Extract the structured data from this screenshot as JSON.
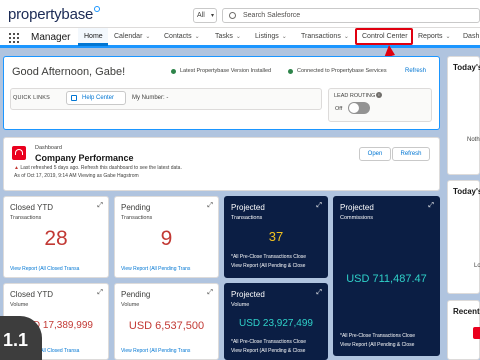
{
  "header": {
    "logo_text": "propertybase",
    "search_scope": "All",
    "search_placeholder": "Search Salesforce"
  },
  "nav": {
    "app_name": "Manager",
    "tabs": [
      {
        "label": "Home",
        "active": true
      },
      {
        "label": "Calendar"
      },
      {
        "label": "Contacts"
      },
      {
        "label": "Tasks"
      },
      {
        "label": "Listings"
      },
      {
        "label": "Transactions"
      },
      {
        "label": "Control Center",
        "highlighted": true
      },
      {
        "label": "Reports"
      },
      {
        "label": "Dash"
      }
    ]
  },
  "greeting": {
    "title": "Good Afternoon, Gabe!",
    "status_version": "Latest Propertybase Version Installed",
    "status_connected": "Connected to Propertybase Services",
    "refresh_label": "Refresh",
    "quick_links_label": "QUICK LINKS",
    "help_center_label": "Help Center",
    "my_number": "My Number: -",
    "lead_routing_label": "LEAD ROUTING",
    "lead_routing_state": "Off"
  },
  "dashboard": {
    "kicker": "Dashboard",
    "title": "Company Performance",
    "refresh_warning": "Last refreshed 5 days ago. Refresh this dashboard to see the latest data.",
    "as_of": "As of Oct 17, 2019, 9:14 AM Viewing as Gabe Hagstrom",
    "open_label": "Open",
    "refresh_label": "Refresh"
  },
  "tiles": {
    "closed_tx": {
      "title": "Closed YTD",
      "subtitle": "Transactions",
      "value": "28",
      "link": "View Report (All Closed Transa"
    },
    "pending_tx": {
      "title": "Pending",
      "subtitle": "Transactions",
      "value": "9",
      "link": "View Report (All Pending Trans"
    },
    "proj_tx": {
      "title": "Projected",
      "subtitle": "Transactions",
      "value": "37",
      "foot1": "*All Pre-Close Transactions Close",
      "foot2": "View Report (All Pending & Close"
    },
    "proj_comm": {
      "title": "Projected",
      "subtitle": "Commissions",
      "value": "USD 711,487.47"
    },
    "closed_vol": {
      "title": "Closed YTD",
      "subtitle": "Volume",
      "value": "USD 17,389,999",
      "link": "View Report (All Closed Transa"
    },
    "pending_vol": {
      "title": "Pending",
      "subtitle": "Volume",
      "value": "USD 6,537,500",
      "link": "View Report (All Pending Trans"
    },
    "proj_vol": {
      "title": "Projected",
      "subtitle": "Volume",
      "value": "USD 23,927,499",
      "foot1": "*All Pre-Close Transactions Close",
      "foot2": "View Report (All Pending & Close"
    },
    "proj_comm_foot1": "*All Pre-Close Transactions Close",
    "proj_comm_foot2": "View Report (All Pending & Close"
  },
  "rail": {
    "card1_title": "Today's",
    "card1_frag": "Noth",
    "card2_title": "Today's",
    "card2_frag": "Lo",
    "card3_title": "Recent I"
  },
  "overlay": {
    "badge": "1.1"
  },
  "colors": {
    "accent": "#1b96ff",
    "highlight_red": "#e00010",
    "value_red": "#c23934",
    "dark_tile": "#0b1e44",
    "teal": "#2fd1c9",
    "gold": "#f0c020"
  }
}
